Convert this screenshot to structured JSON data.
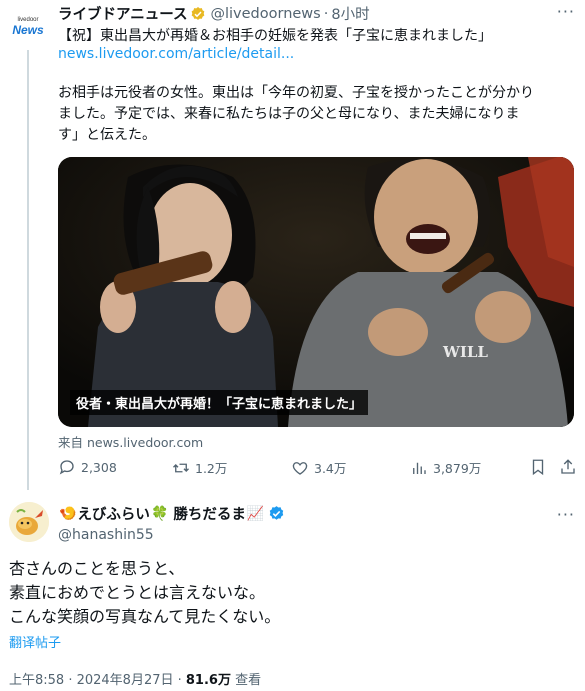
{
  "parent": {
    "account_logo_top": "livedoor",
    "account_logo_bottom": "News",
    "display_name": "ライブドアニュース",
    "handle": "@livedoornews",
    "time": "8小时",
    "separator": "·",
    "headline": "【祝】東出昌大が再婚＆お相手の妊娠を発表「子宝に恵まれました」",
    "link": "news.livedoor.com/article/detail...",
    "body_lines": [
      "お相手は元役者の女性。東出は「今年の初夏、子宝を授かったことが分かり",
      "ました。予定では、来春に私たちは子の父と母になり、また夫婦になりま",
      "す」と伝えた。"
    ],
    "media_caption": "役者・東出昌大が再婚！「子宝に恵まれました」",
    "media_shirt_text": "WILL",
    "source": "来自 news.livedoor.com",
    "replies": "2,308",
    "retweets": "1.2万",
    "likes": "3.4万",
    "views": "3,879万",
    "badge_color": "#e8b923"
  },
  "tweet": {
    "name_part1": "えびふらい",
    "name_part2": "勝ちだるま",
    "name_emoji_1": "🍤",
    "name_emoji_2": "🍀",
    "name_emoji_3": "📈",
    "handle": "@hanashin55",
    "body_lines": [
      "杏さんのことを思うと、",
      "素直におめでとうとは言えないな。",
      "こんな笑顔の写真なんて見たくない。"
    ],
    "translate": "翻译帖子",
    "time": "上午8:58 · 2024年8月27日 · ",
    "views_count": "81.6万",
    "views_label": " 查看",
    "verified_color": "#1d9bf0"
  }
}
